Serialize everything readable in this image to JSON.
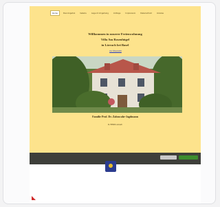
{
  "nav": {
    "items": [
      "Home",
      "Das Angebot",
      "Galerie",
      "Lage & Umgebung",
      "Anfrage",
      "Impressum",
      "Datenschutz",
      "Anreise"
    ],
    "active_index": 0
  },
  "header": {
    "tagline": "",
    "subnote": ""
  },
  "welcome": {
    "line1": "Willkommen in unserer Ferienwohnung",
    "line2": "Villa Am Rosenhügel",
    "line3": "in Lörrach bei Basel"
  },
  "map_link": "zur Übersicht",
  "owner": {
    "name": "Familie Prof. Dr. Zahnwahr-Jagdmann",
    "street": "",
    "city": "D-79539 Lörrach",
    "phone": "",
    "email": ""
  },
  "footer_lines": [],
  "cookie": {
    "text": "",
    "decline_label": "",
    "accept_label": ""
  },
  "colors": {
    "page_bg": "#fde38c",
    "cookie_bg": "#3e3f3a",
    "accept_btn": "#3d8d2f",
    "link": "#1a35c4"
  }
}
